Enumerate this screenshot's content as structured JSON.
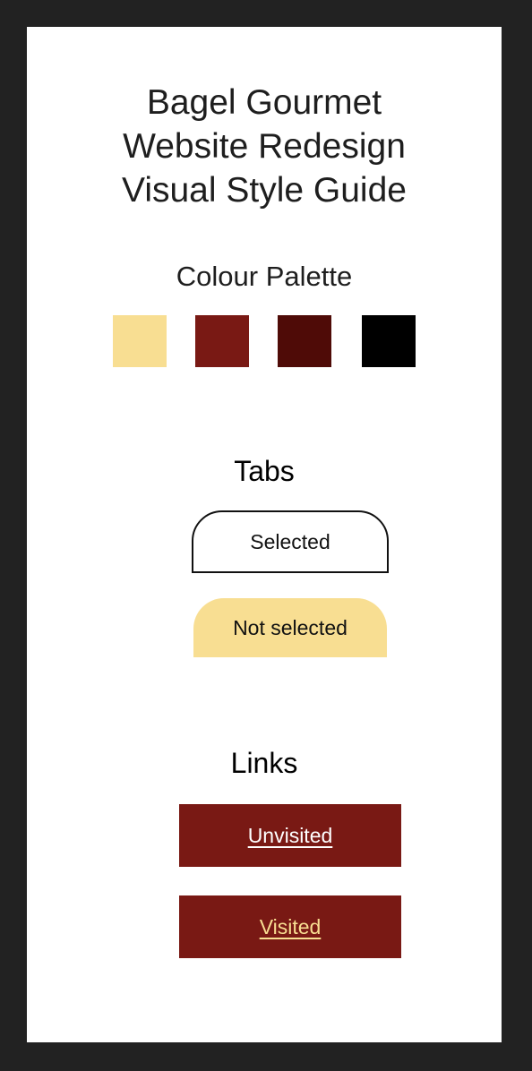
{
  "title": {
    "line1": "Bagel Gourmet",
    "line2": "Website Redesign",
    "line3": "Visual Style Guide"
  },
  "palette": {
    "heading": "Colour Palette",
    "colors": [
      "#f8de92",
      "#791914",
      "#4f0b07",
      "#000000"
    ]
  },
  "tabs": {
    "heading": "Tabs",
    "selected_label": "Selected",
    "unselected_label": "Not selected",
    "unselected_color": "#f8de92"
  },
  "links": {
    "heading": "Links",
    "unvisited_label": "Unvisited",
    "visited_label": "Visited",
    "background_color": "#791914",
    "unvisited_color": "#ffffff",
    "visited_color": "#f8de92"
  }
}
